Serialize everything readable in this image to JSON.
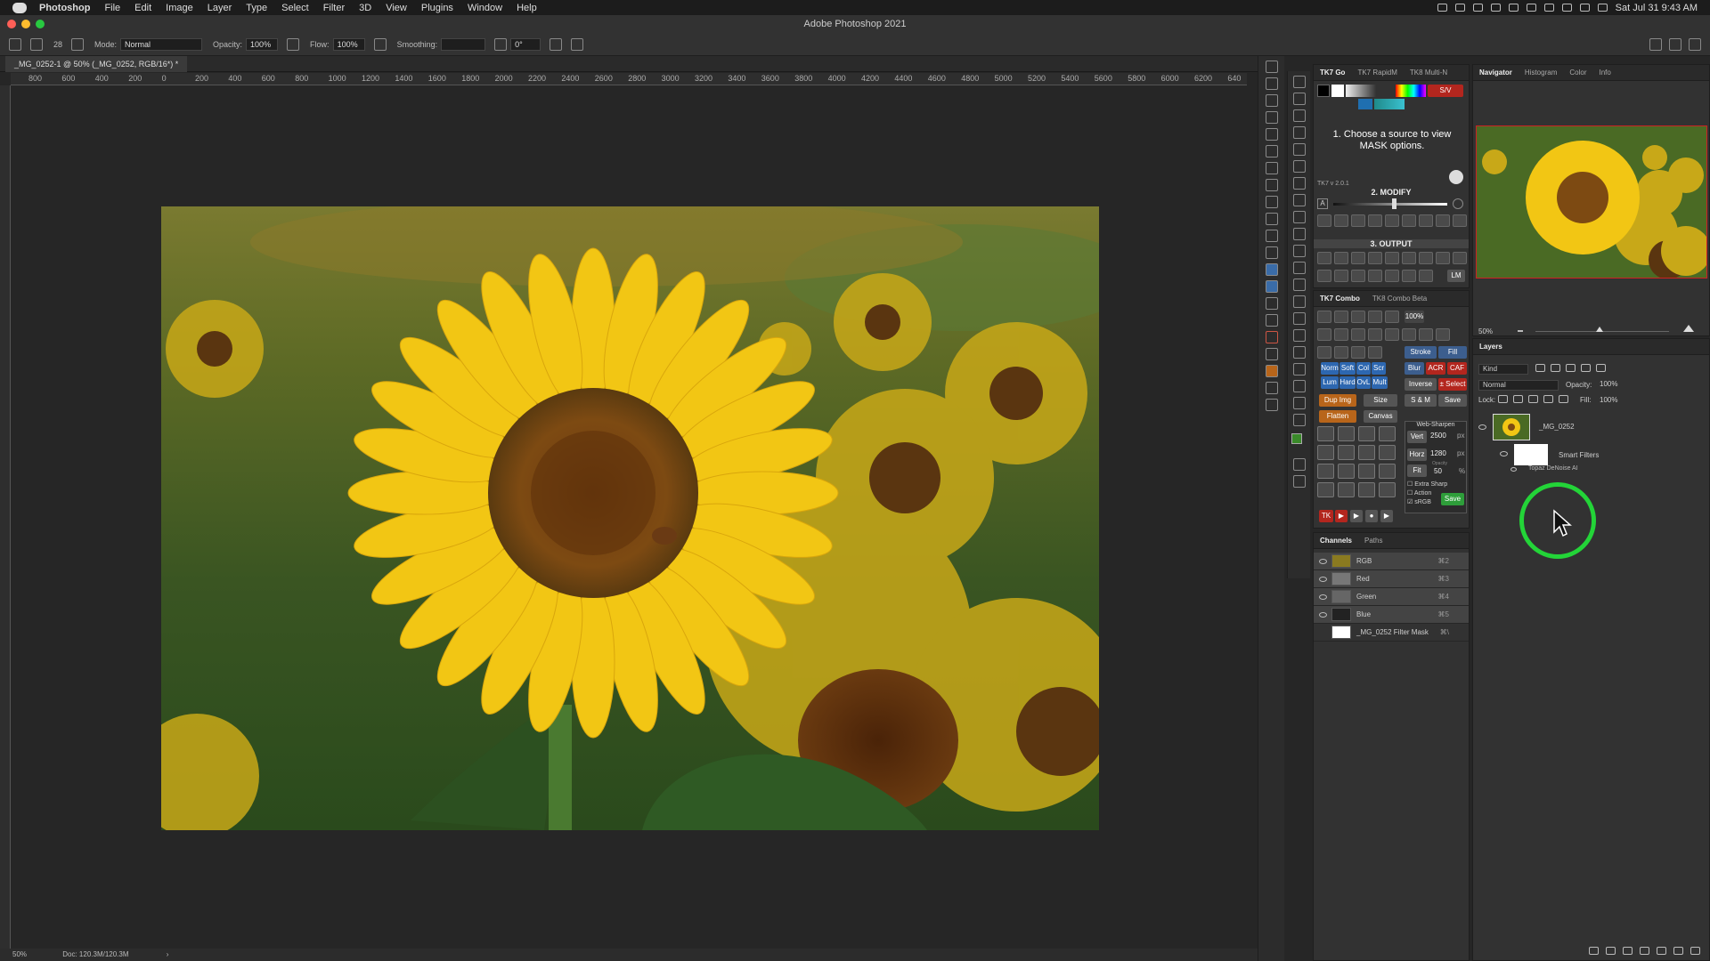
{
  "menubar": {
    "app": "Photoshop",
    "items": [
      "File",
      "Edit",
      "Image",
      "Layer",
      "Type",
      "Select",
      "Filter",
      "3D",
      "View",
      "Plugins",
      "Window",
      "Help"
    ],
    "datetime": "Sat Jul 31  9:43 AM"
  },
  "window": {
    "title": "Adobe Photoshop 2021"
  },
  "options": {
    "brush_size": "28",
    "mode_label": "Mode:",
    "mode_value": "Normal",
    "opacity_label": "Opacity:",
    "opacity_value": "100%",
    "flow_label": "Flow:",
    "flow_value": "100%",
    "smoothing_label": "Smoothing:",
    "angle_value": "0°"
  },
  "document": {
    "tab": "_MG_0252-1 @ 50% (_MG_0252, RGB/16*) *",
    "ruler_ticks": [
      "800",
      "600",
      "400",
      "200",
      "0",
      "200",
      "400",
      "600",
      "800",
      "1000",
      "1200",
      "1400",
      "1600",
      "1800",
      "2000",
      "2200",
      "2400",
      "2600",
      "2800",
      "3000",
      "3200",
      "3400",
      "3600",
      "3800",
      "4000",
      "4200",
      "4400",
      "4600",
      "4800",
      "5000",
      "5200",
      "5400",
      "5600",
      "5800",
      "6000",
      "6200",
      "640"
    ],
    "zoom": "50%",
    "doc_size": "Doc: 120.3M/120.3M"
  },
  "tk7go": {
    "tabs": [
      "TK7 Go",
      "TK7 RapidM",
      "TK8 Multi-N"
    ],
    "sv_label": "S/V",
    "instructions": "1. Choose a source to view MASK options.",
    "version": "TK7 v 2.0.1",
    "modify_title": "2. MODIFY",
    "output_title": "3. OUTPUT",
    "lm_label": "LM",
    "a_label": "A"
  },
  "tk7combo": {
    "tabs": [
      "TK7 Combo",
      "TK8 Combo Beta"
    ],
    "pct": "100%",
    "stroke": "Stroke",
    "fill": "Fill",
    "blends": [
      "Norm",
      "Soft",
      "Col",
      "Scr"
    ],
    "blends2": [
      "Lum",
      "Hard",
      "OvL",
      "Mult"
    ],
    "blur": "Blur",
    "acr": "ACR",
    "caf": "CAF",
    "inverse": "Inverse",
    "select": "± Select",
    "dup": "Dup Img",
    "size": "Size",
    "sm": "S & M",
    "save": "Save",
    "flatten": "Flatten",
    "canvas": "Canvas",
    "websharpen": "Web-Sharpen",
    "vert_label": "Vert",
    "vert_value": "2500",
    "vert_unit": "px",
    "horz_label": "Horz",
    "horz_value": "1280",
    "horz_unit": "px",
    "fit_label": "Fit",
    "opacity_label": "Opacity",
    "opacity_value": "50",
    "opacity_unit": "%",
    "extra_sharp": "Extra Sharp",
    "action": "Action",
    "srgb": "sRGB",
    "save2": "Save",
    "tk_label": "TK"
  },
  "channels": {
    "tabs": [
      "Channels",
      "Paths"
    ],
    "items": [
      {
        "name": "RGB",
        "key": "⌘2"
      },
      {
        "name": "Red",
        "key": "⌘3"
      },
      {
        "name": "Green",
        "key": "⌘4"
      },
      {
        "name": "Blue",
        "key": "⌘5"
      },
      {
        "name": "_MG_0252 Filter Mask",
        "key": "⌘\\"
      }
    ]
  },
  "navigator": {
    "tabs": [
      "Navigator",
      "Histogram",
      "Color",
      "Info"
    ],
    "zoom": "50%"
  },
  "layers": {
    "tab": "Layers",
    "kind": "Kind",
    "blend": "Normal",
    "opacity_label": "Opacity:",
    "opacity_value": "100%",
    "lock_label": "Lock:",
    "fill_label": "Fill:",
    "fill_value": "100%",
    "layer_name": "_MG_0252",
    "smart_filters": "Smart Filters",
    "filter_name": "Topaz DeNoise AI"
  },
  "colors": {
    "accent_green": "#23d438",
    "tk_red": "#b3261e",
    "tk_blue": "#2d67b0",
    "tk_orange": "#b8651a",
    "tk_green": "#2e9e3a"
  }
}
